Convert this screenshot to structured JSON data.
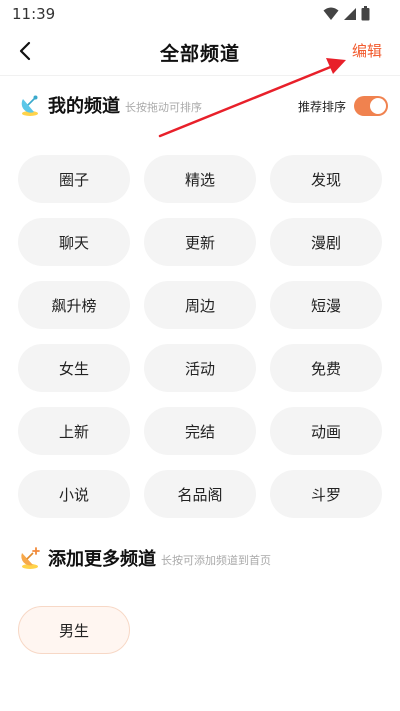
{
  "status_bar": {
    "time": "11:39"
  },
  "nav": {
    "title": "全部频道",
    "edit_label": "编辑"
  },
  "my_channels": {
    "title": "我的频道",
    "hint": "长按拖动可排序",
    "sort_label": "推荐排序",
    "sort_enabled": true,
    "items": [
      "圈子",
      "精选",
      "发现",
      "聊天",
      "更新",
      "漫剧",
      "飙升榜",
      "周边",
      "短漫",
      "女生",
      "活动",
      "免费",
      "上新",
      "完结",
      "动画",
      "小说",
      "名品阁",
      "斗罗"
    ]
  },
  "more_channels": {
    "title": "添加更多频道",
    "hint": "长按可添加频道到首页",
    "items": [
      "男生"
    ]
  },
  "colors": {
    "accent": "#f25b2e",
    "toggle": "#f0824f",
    "chip_bg": "#f4f4f4",
    "arrow": "#e8202a"
  },
  "icons": {
    "back": "chevron-left-icon",
    "my_channels": "satellite-dish-icon",
    "more_channels": "add-satellite-icon"
  }
}
